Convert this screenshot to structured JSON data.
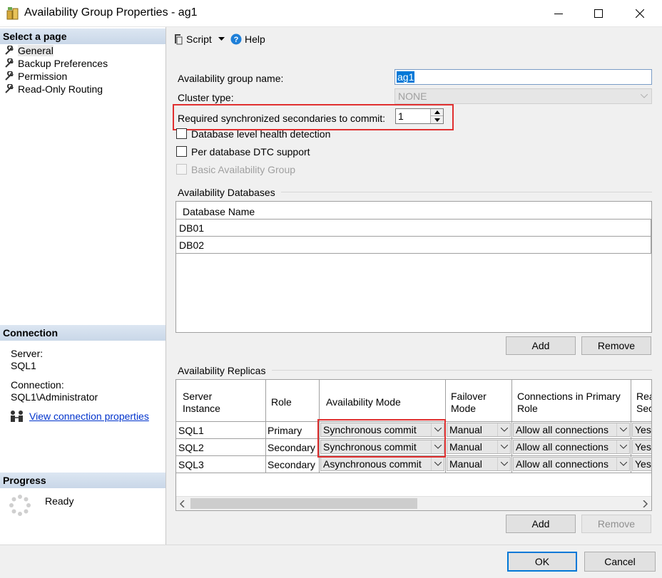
{
  "window": {
    "title": "Availability Group Properties - ag1",
    "minimize_glyph": "—",
    "maximize_glyph": "☐",
    "close_glyph": "✕"
  },
  "left_panel": {
    "select_page_header": "Select a page",
    "pages": [
      {
        "label": "General",
        "icon": "wrench-icon",
        "selected": true
      },
      {
        "label": "Backup Preferences",
        "icon": "wrench-icon"
      },
      {
        "label": "Permission",
        "icon": "wrench-icon"
      },
      {
        "label": "Read-Only Routing",
        "icon": "wrench-icon"
      }
    ],
    "connection_header": "Connection",
    "server_label": "Server:",
    "server_value": "SQL1",
    "connection_label": "Connection:",
    "connection_value": "SQL1\\Administrator",
    "view_connection_link": "View connection properties",
    "progress_header": "Progress",
    "progress_status": "Ready"
  },
  "toolbar": {
    "script_label": "Script",
    "help_label": "Help"
  },
  "general": {
    "ag_name_label": "Availability group name:",
    "ag_name_value": "ag1",
    "cluster_type_label": "Cluster type:",
    "cluster_type_value": "NONE",
    "required_sync_label": "Required synchronized secondaries to commit:",
    "required_sync_value": "1",
    "db_health_label": "Database level health detection",
    "dtc_label": "Per database DTC support",
    "basic_ag_label": "Basic Availability Group"
  },
  "databases": {
    "group_label": "Availability Databases",
    "column_header": "Database Name",
    "rows": [
      "DB01",
      "DB02"
    ],
    "add_label": "Add",
    "remove_label": "Remove"
  },
  "replicas": {
    "group_label": "Availability Replicas",
    "headers": {
      "server_instance_1": "Server",
      "server_instance_2": "Instance",
      "role": "Role",
      "availability_mode": "Availability Mode",
      "failover_mode_1": "Failover",
      "failover_mode_2": "Mode",
      "connections_1": "Connections in Primary",
      "connections_2": "Role",
      "readable_1": "Rea",
      "readable_2": "Sec"
    },
    "rows": [
      {
        "server": "SQL1",
        "role": "Primary",
        "mode": "Synchronous commit",
        "failover": "Manual",
        "connections": "Allow all connections",
        "readable": "Yes"
      },
      {
        "server": "SQL2",
        "role": "Secondary",
        "mode": "Synchronous commit",
        "failover": "Manual",
        "connections": "Allow all connections",
        "readable": "Yes"
      },
      {
        "server": "SQL3",
        "role": "Secondary",
        "mode": "Asynchronous commit",
        "failover": "Manual",
        "connections": "Allow all connections",
        "readable": "Yes"
      }
    ],
    "add_label": "Add",
    "remove_label": "Remove"
  },
  "footer": {
    "ok_label": "OK",
    "cancel_label": "Cancel"
  },
  "colors": {
    "highlight_red": "#e03030",
    "link_blue": "#0033cc",
    "ok_border": "#0078d7",
    "section_header": "#dce6f2"
  }
}
